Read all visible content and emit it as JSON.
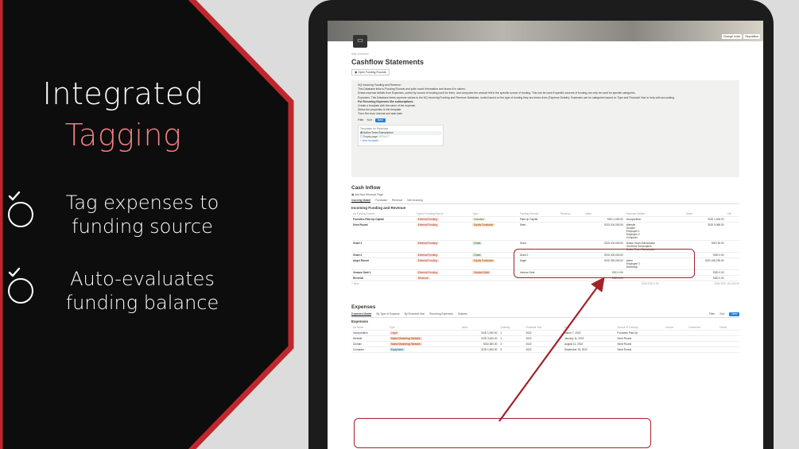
{
  "promo": {
    "headline_1": "Integrated",
    "headline_2": "Tagging",
    "features": [
      {
        "text_1": "Tag expenses to",
        "text_2": "funding source"
      },
      {
        "text_1": "Auto-evaluates",
        "text_2": "funding balance"
      }
    ],
    "colors": {
      "panel": "#0d0d0d",
      "border": "#c0272d",
      "accent": "#f07f86"
    }
  },
  "cover": {
    "buttons": [
      "Change cover",
      "Reposition"
    ]
  },
  "page": {
    "add_comment": "Add comment",
    "title": "Cashflow Statements",
    "open_button": "Open Funding Rounds",
    "callout": {
      "lines": [
        "NQ Incoming Funding and Revenue :",
        "This Database links to Funding Rounds and pulls round information and stores it in values.",
        "Draws expense details from Expenses, sorted by source of funding used for them, and computes the amount left in the specific source of funding. This can be used if specific sources of funding can only be used for specific categories.",
        "Expenses: This Database feeds expense values to the NQ Incoming Funding and Revenue Database, sorted based on the type of funding they are drawn from (Expense Details). Expenses can be categories based on Type and Financial Year to help with accounting.",
        "For Recurring Expenses like subscriptions:",
        "Create a template with the name of the expense.",
        "Select the properties in the template.",
        "Then Set recur interval and start date"
      ],
      "toolbar": [
        "Filter",
        "Sort",
        "New"
      ],
      "templates_header": "Templates for Expenses",
      "templates": [
        {
          "name": "Notion Team Subscription",
          "badge": ""
        },
        {
          "name": "Empty page",
          "badge": "DEFAULT"
        }
      ],
      "new_template": "New template"
    },
    "inflow": {
      "title": "Cash Inflow",
      "add_button": "Add New Revenue Page",
      "tabs": [
        "Incoming Master",
        "Fundraise",
        "Revenue",
        "Net Incoming"
      ],
      "db_title": "Incoming Funding and Revenue",
      "columns": [
        "Aa Funding Source",
        "Type of Funding Source",
        "Type",
        "Funding Rounds",
        "Revenue",
        "Value",
        "Expense Details",
        "Spent",
        "Left"
      ],
      "rows": [
        {
          "name": "Founders Paid Up Capital",
          "source": "External Funding",
          "stype": "ext",
          "type": "Donation",
          "ttype": "don",
          "round": "Paid-Up Capital",
          "value": "SGD 1,000.00",
          "details": [
            "Incorporation"
          ],
          "spent": "SGD 1,000.00"
        },
        {
          "name": "Seed Round",
          "source": "External Funding",
          "stype": "ext",
          "type": "Equity Fundraise",
          "ttype": "eq",
          "round": "Seed",
          "value": "SGD 100,000.00",
          "details": [
            "Website",
            "Domain",
            "Employee 1",
            "Employee 2",
            "Computer"
          ],
          "spent": "SGD 9,969.00"
        },
        {
          "name": "Grant 1",
          "source": "External Funding",
          "stype": "ext",
          "type": "Grant",
          "ttype": "grant",
          "round": "Grant",
          "value": "SGD 100,000.00",
          "details": [
            "Notion Team Subscription",
            "OneDrive Subscription",
            "Notion Team Subscription"
          ],
          "spent": "SGD 30.00"
        },
        {
          "name": "Grant 2",
          "source": "External Funding",
          "stype": "ext",
          "type": "Grant",
          "ttype": "grant",
          "round": "Grant 2",
          "value": "SGD 200,000.00",
          "details": [],
          "spent": "SGD 0.00"
        },
        {
          "name": "Angel Round",
          "source": "External Funding",
          "stype": "ext",
          "type": "Equity Fundraise",
          "ttype": "eq",
          "round": "Angel",
          "value": "SGD 320,000.00",
          "details": [
            "Intern",
            "Employee 3",
            "Workshop"
          ],
          "spent": "SGD 106,239.00"
        },
        {
          "name": "Venture Debt 1",
          "source": "External Funding",
          "stype": "ext",
          "type": "Venture Debt",
          "ttype": "vd",
          "round": "Venture Debt",
          "value": "SGD 0.00",
          "details": [],
          "spent": "SGD 0.00"
        },
        {
          "name": "Revenue",
          "source": "Revenue",
          "stype": "rev",
          "type": "",
          "ttype": "",
          "round": "",
          "value": "SGD 0.00",
          "details": [],
          "spent": "SGD 0.00"
        }
      ],
      "new_row": "+ New",
      "sum_revenue": "SUM SGD 0.00",
      "sum_spent": "SUM SGD 110,240.00"
    },
    "expenses": {
      "title": "Expenses",
      "tabs": [
        "Expenses Master",
        "By Type of Expense",
        "By Financial Year",
        "Recurring Expenses",
        "Salaries"
      ],
      "toolbar": [
        "Filter",
        "Sort",
        "New"
      ],
      "db_title": "Expenses",
      "columns": [
        "Aa Name",
        "Type",
        "Value",
        "Quantity",
        "Financial Year",
        "Date",
        "Source of Funding",
        "Invoice",
        "Comments",
        "Parent"
      ],
      "rows": [
        {
          "name": "Incorporation",
          "type": "Legal",
          "ttype": "legal",
          "value": "SGD 1,000.00",
          "qty": "1",
          "fy": "2022",
          "date": "March 7, 2022",
          "source": "Founders Paid Up"
        },
        {
          "name": "Website",
          "type": "Sales/ Marketing/ Website",
          "ttype": "sales",
          "value": "SGD 3,000.00",
          "qty": "1",
          "fy": "2022",
          "date": "January 11, 2022",
          "source": "Seed Round"
        },
        {
          "name": "Domain",
          "type": "Sales/ Marketing/ Website",
          "ttype": "sales",
          "value": "SGD 350.00",
          "qty": "3",
          "fy": "2022",
          "date": "August 12, 2022",
          "source": "Seed Round"
        },
        {
          "name": "Computer",
          "type": "Equipment",
          "ttype": "eqp",
          "value": "SGD 1,500.00",
          "qty": "3",
          "fy": "2022",
          "date": "September 15, 2022",
          "source": "Seed Round"
        }
      ]
    }
  }
}
